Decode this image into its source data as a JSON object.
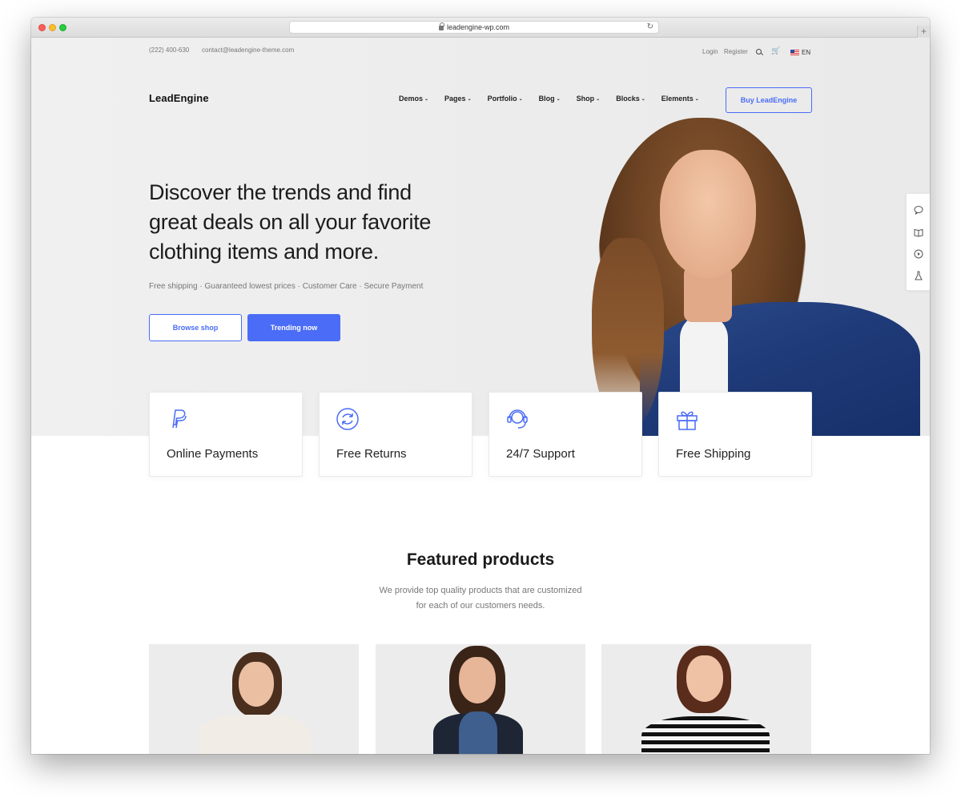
{
  "browser": {
    "url": "leadengine-wp.com"
  },
  "topbar": {
    "phone": "(222) 400-630",
    "email": "contact@leadengine-theme.com",
    "login": "Login",
    "register": "Register",
    "language": "EN"
  },
  "header": {
    "logo": "LeadEngine",
    "nav": {
      "demos": "Demos",
      "pages": "Pages",
      "portfolio": "Portfolio",
      "blog": "Blog",
      "shop": "Shop",
      "blocks": "Blocks",
      "elements": "Elements"
    },
    "buy_label": "Buy LeadEngine"
  },
  "hero": {
    "headline": "Discover the trends and find great deals on all your favorite clothing items and more.",
    "subline": "Free shipping · Guaranteed lowest prices · Customer Care · Secure Payment",
    "browse_label": "Browse shop",
    "trending_label": "Trending now"
  },
  "features": {
    "payments": "Online Payments",
    "returns": "Free Returns",
    "support": "24/7 Support",
    "shipping": "Free Shipping"
  },
  "featured": {
    "title": "Featured products",
    "desc_line1": "We provide top quality products that are customized",
    "desc_line2": "for each of our customers needs."
  },
  "colors": {
    "accent": "#4a6cf7",
    "hero_bg": "#ececec"
  },
  "icons": [
    "lock-icon",
    "reload-icon",
    "search-icon",
    "cart-icon",
    "flag-icon",
    "chevron-down-icon",
    "chat-icon",
    "book-icon",
    "play-icon",
    "flask-icon",
    "paypal-icon",
    "refresh-icon",
    "headset-icon",
    "gift-icon"
  ]
}
